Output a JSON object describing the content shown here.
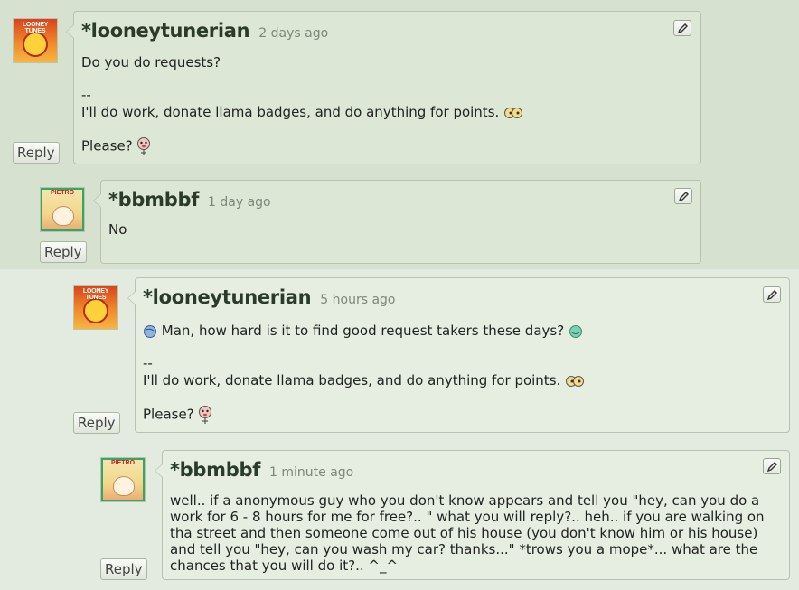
{
  "comments": [
    {
      "username": "*looneytunerian",
      "time": "2 days ago",
      "reply_label": "Reply",
      "avatar_text": "LOONEY TUNES",
      "lines": [
        "Do you do requests?",
        "--",
        "I'll do work, donate llama badges, and do anything for points.",
        "Please?"
      ]
    },
    {
      "username": "*bbmbbf",
      "time": "1 day ago",
      "reply_label": "Reply",
      "avatar_text": "PIETRO",
      "lines": [
        "No"
      ]
    },
    {
      "username": "*looneytunerian",
      "time": "5 hours ago",
      "reply_label": "Reply",
      "avatar_text": "LOONEY TUNES",
      "lines": [
        "Man, how hard is it to find good request takers these days?",
        "--",
        "I'll do work, donate llama badges, and do anything for points.",
        "Please?"
      ]
    },
    {
      "username": "*bbmbbf",
      "time": "1 minute ago",
      "reply_label": "Reply",
      "avatar_text": "PIETRO",
      "lines": [
        "well.. if a anonymous guy who you don't know appears and tell you \"hey, can you do a",
        "work for 6 - 8 hours for me for free?.. \" what you will reply?.. heh.. if you are walking on",
        "tha street and then someone come out of his house (you don't know him or his house)",
        "and tell you \"hey, can you wash my car? thanks...\" *trows you a mope*... what are the",
        "chances that you will do it?.. ^_^"
      ]
    }
  ],
  "colors": {
    "username": "#2b3b2a",
    "timestamp": "#7d877a",
    "bubble": "#dde7d5",
    "border": "#b7c3ae"
  },
  "icons": [
    "edit-pencil-icon",
    "goggle-eyes-emoticon",
    "please-emoticon",
    "globe-emoticon"
  ]
}
